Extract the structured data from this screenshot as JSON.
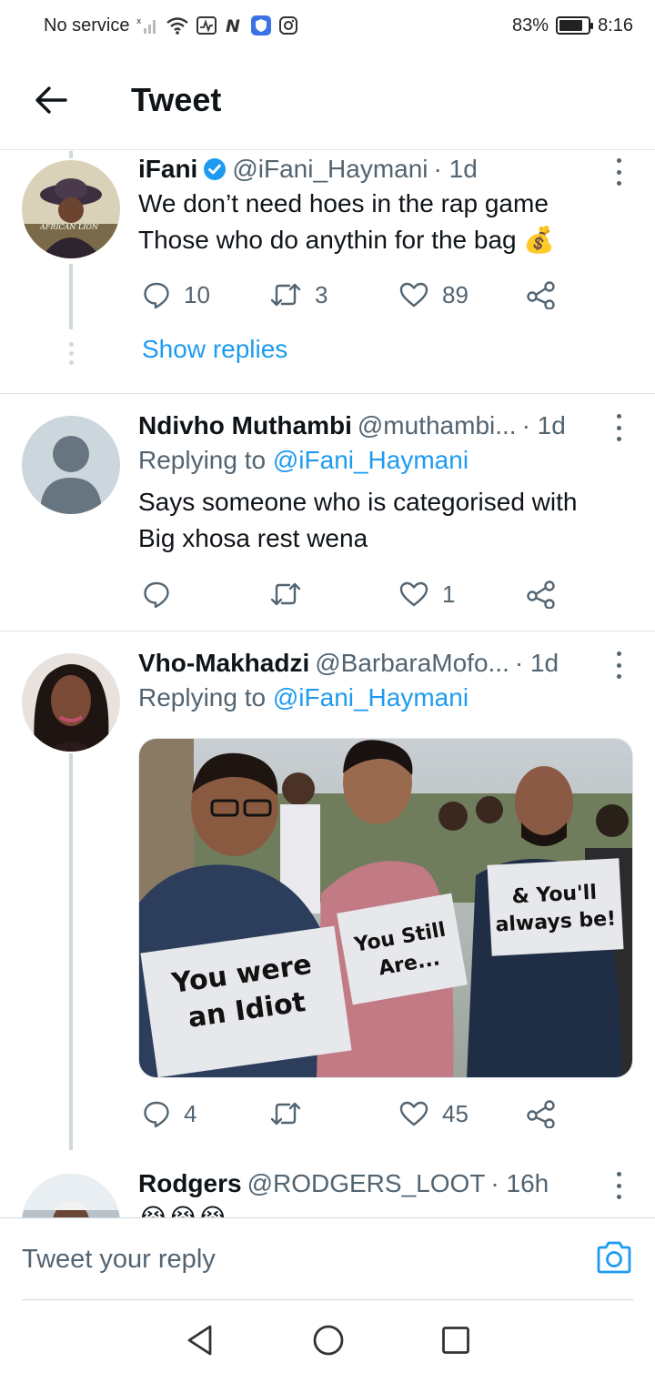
{
  "status_bar": {
    "carrier": "No service",
    "battery": "83%",
    "battery_level": 0.83,
    "time": "8:16"
  },
  "header": {
    "title": "Tweet"
  },
  "tweets": [
    {
      "name": "iFani",
      "handle": "@iFani_Haymani",
      "time": "· 1d",
      "verified": true,
      "avatar_text": "AFRICAN LION",
      "lines": [
        "We don’t need hoes in the rap game",
        "Those who do anythin for the bag 💰"
      ],
      "replies": "10",
      "retweets": "3",
      "likes": "89",
      "show_replies": "Show replies"
    },
    {
      "name": "Ndivho Muthambi",
      "handle": "@muthambi...",
      "time": "· 1d",
      "replying_prefix": "Replying to ",
      "replying_handle": "@iFani_Haymani",
      "lines": [
        "Says someone who is categorised with",
        "Big xhosa rest wena"
      ],
      "replies": "",
      "retweets": "",
      "likes": "1"
    },
    {
      "name": "Vho-Makhadzi",
      "handle": "@BarbaraMofo...",
      "time": "· 1d",
      "replying_prefix": "Replying to ",
      "replying_handle": "@iFani_Haymani",
      "media_signs": [
        "You were an Idiot",
        "You Still Are...",
        "& You'll always be!"
      ],
      "replies": "4",
      "retweets": "",
      "likes": "45"
    },
    {
      "name": "Rodgers",
      "handle": "@RODGERS_LOOT",
      "time": "· 16h",
      "lines": [
        "😭😭😭"
      ]
    }
  ],
  "reply_bar": {
    "placeholder": "Tweet your reply"
  },
  "colors": {
    "accent": "#1d9bf0",
    "secondary_text": "#536471",
    "divider": "#e1e6ea"
  },
  "icons": [
    "back-arrow-icon",
    "verified-icon",
    "reply-icon",
    "retweet-icon",
    "like-icon",
    "share-icon",
    "more-icon",
    "camera-icon",
    "nav-back-icon",
    "nav-home-icon",
    "nav-recents-icon"
  ]
}
